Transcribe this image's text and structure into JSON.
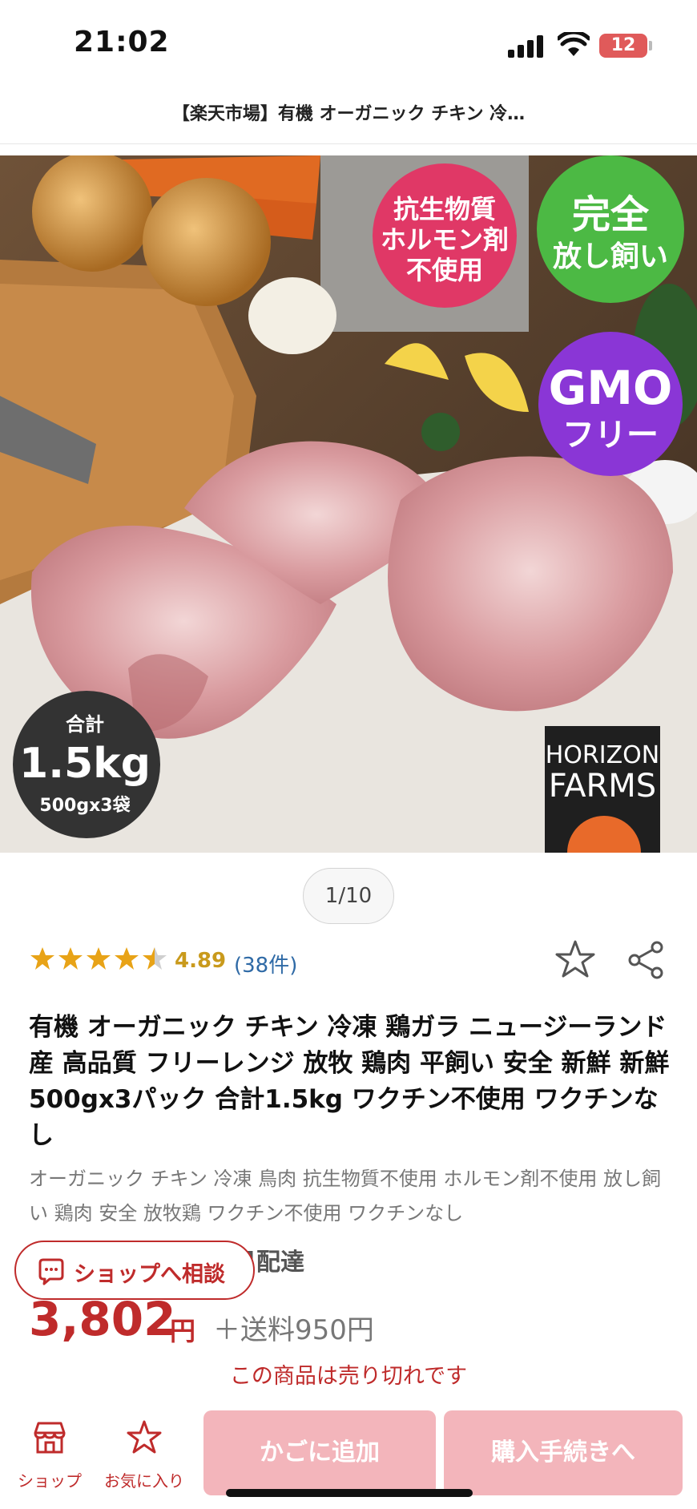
{
  "status_bar": {
    "time": "21:02",
    "battery": "12"
  },
  "header": {
    "title": "【楽天市場】有機 オーガニック チキン 冷…"
  },
  "hero": {
    "badge_antibiotic": [
      "抗生物質",
      "ホルモン剤",
      "不使用"
    ],
    "badge_freerange": [
      "完全",
      "放し飼い"
    ],
    "badge_gmo": [
      "GMO",
      "フリー"
    ],
    "badge_total": {
      "label": "合計",
      "weight": "1.5kg",
      "detail": "500gx3袋"
    },
    "brand": [
      "HORIZON",
      "FARMS"
    ],
    "colors": {
      "pink_badge": "#e03866",
      "green_badge": "#4cb944",
      "purple_badge": "#8a36d6"
    }
  },
  "gallery": {
    "counter": "1/10"
  },
  "rating": {
    "value": "4.89",
    "count": "(38件)",
    "stars": 4.89
  },
  "product": {
    "title": "有機 オーガニック チキン 冷凍 鶏ガラ ニュージーランド産 高品質 フリーレンジ 放牧 鶏肉 平飼い 安全 新鮮 新鮮 500gx3パック 合計1.5kg ワクチン不使用 ワクチンなし",
    "subtitle": "オーガニック チキン 冷凍 鳥肉 抗生物質不使用 ホルモン剤不使用 放し飼い 鶏肉 安全 放牧鶏 ワクチン不使用 ワクチンなし",
    "delivery": "日配達",
    "price": "3,802",
    "price_unit": "円",
    "shipping": "＋送料950円",
    "soldout": "この商品は売り切れです"
  },
  "consult": {
    "label": "ショップへ相談"
  },
  "bottom_nav": {
    "shop_label": "ショップ",
    "fav_label": "お気に入り",
    "cart_label": "かごに追加",
    "buy_label": "購入手続きへ"
  },
  "colors": {
    "accent": "#bf2b2b",
    "disabled_button": "#f3b5bb",
    "star": "#e8a317"
  }
}
